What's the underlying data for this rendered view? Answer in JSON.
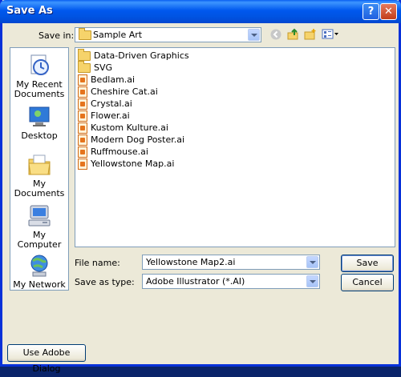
{
  "window": {
    "title": "Save As",
    "help_glyph": "?",
    "close_glyph": "✕"
  },
  "toolbar": {
    "save_in_label": "Save in:",
    "save_in_value": "Sample Art",
    "icons": [
      "back-icon",
      "up-folder-icon",
      "new-folder-icon",
      "views-menu-icon"
    ]
  },
  "places": [
    {
      "label": "My Recent Documents",
      "icon": "recent-documents-icon"
    },
    {
      "label": "Desktop",
      "icon": "desktop-icon"
    },
    {
      "label": "My Documents",
      "icon": "my-documents-icon"
    },
    {
      "label": "My Computer",
      "icon": "my-computer-icon"
    },
    {
      "label": "My Network",
      "icon": "my-network-icon"
    }
  ],
  "files": [
    {
      "name": "Data-Driven Graphics",
      "type": "folder"
    },
    {
      "name": "SVG",
      "type": "folder"
    },
    {
      "name": "Bedlam.ai",
      "type": "ai"
    },
    {
      "name": "Cheshire Cat.ai",
      "type": "ai"
    },
    {
      "name": "Crystal.ai",
      "type": "ai"
    },
    {
      "name": "Flower.ai",
      "type": "ai"
    },
    {
      "name": "Kustom Kulture.ai",
      "type": "ai"
    },
    {
      "name": "Modern Dog Poster.ai",
      "type": "ai"
    },
    {
      "name": "Ruffmouse.ai",
      "type": "ai"
    },
    {
      "name": "Yellowstone Map.ai",
      "type": "ai"
    }
  ],
  "form": {
    "file_name_label": "File name:",
    "file_name_value": "Yellowstone Map2.ai",
    "save_as_type_label": "Save as type:",
    "save_as_type_value": "Adobe Illustrator (*.AI)"
  },
  "buttons": {
    "save": "Save",
    "cancel": "Cancel",
    "adobe_dialog": "Use Adobe Dialog"
  },
  "colors": {
    "titlebar": "#0054e3",
    "dialog_bg": "#ece9d8",
    "field_border": "#7f9db9"
  }
}
